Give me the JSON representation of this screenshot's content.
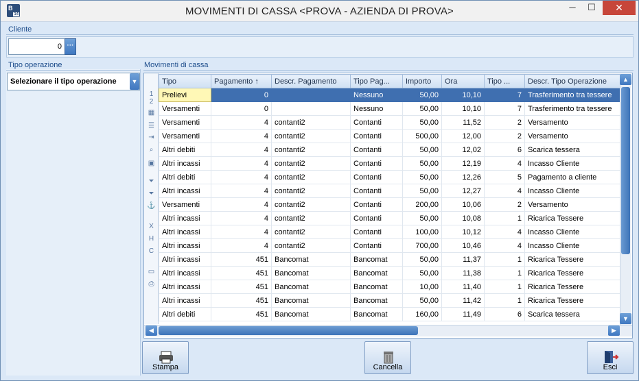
{
  "window": {
    "title": "MOVIMENTI DI CASSA <PROVA - AZIENDA DI PROVA>",
    "app_icon_letter": "B",
    "app_icon_badge": "14",
    "controls": {
      "minimize": "─",
      "maximize": "☐",
      "close": "✕"
    }
  },
  "cliente": {
    "label": "Cliente",
    "value": "0",
    "lookup_button": "···"
  },
  "tipo_operazione": {
    "label": "Tipo operazione",
    "selected": "Selezionare il tipo operazione"
  },
  "grid": {
    "label": "Movimenti di cassa",
    "row_numbers": [
      "1",
      "2"
    ],
    "columns": [
      "Tipo",
      "Pagamento ↑",
      "Descr. Pagamento",
      "Tipo Pag...",
      "Importo",
      "Ora",
      "Tipo ...",
      "Descr. Tipo Operazione"
    ],
    "rows": [
      [
        "Prelievi",
        "0",
        "",
        "Nessuno",
        "50,00",
        "10,10",
        "7",
        "Trasferimento tra tessere"
      ],
      [
        "Versamenti",
        "0",
        "",
        "Nessuno",
        "50,00",
        "10,10",
        "7",
        "Trasferimento tra tessere"
      ],
      [
        "Versamenti",
        "4",
        "contanti2",
        "Contanti",
        "50,00",
        "11,52",
        "2",
        "Versamento"
      ],
      [
        "Versamenti",
        "4",
        "contanti2",
        "Contanti",
        "500,00",
        "12,00",
        "2",
        "Versamento"
      ],
      [
        "Altri debiti",
        "4",
        "contanti2",
        "Contanti",
        "50,00",
        "12,02",
        "6",
        "Scarica tessera"
      ],
      [
        "Altri incassi",
        "4",
        "contanti2",
        "Contanti",
        "50,00",
        "12,19",
        "4",
        "Incasso Cliente"
      ],
      [
        "Altri debiti",
        "4",
        "contanti2",
        "Contanti",
        "50,00",
        "12,26",
        "5",
        "Pagamento a cliente"
      ],
      [
        "Altri incassi",
        "4",
        "contanti2",
        "Contanti",
        "50,00",
        "12,27",
        "4",
        "Incasso Cliente"
      ],
      [
        "Versamenti",
        "4",
        "contanti2",
        "Contanti",
        "200,00",
        "10,06",
        "2",
        "Versamento"
      ],
      [
        "Altri incassi",
        "4",
        "contanti2",
        "Contanti",
        "50,00",
        "10,08",
        "1",
        "Ricarica Tessere"
      ],
      [
        "Altri incassi",
        "4",
        "contanti2",
        "Contanti",
        "100,00",
        "10,12",
        "4",
        "Incasso Cliente"
      ],
      [
        "Altri incassi",
        "4",
        "contanti2",
        "Contanti",
        "700,00",
        "10,46",
        "4",
        "Incasso Cliente"
      ],
      [
        "Altri incassi",
        "451",
        "Bancomat",
        "Bancomat",
        "50,00",
        "11,37",
        "1",
        "Ricarica Tessere"
      ],
      [
        "Altri incassi",
        "451",
        "Bancomat",
        "Bancomat",
        "50,00",
        "11,38",
        "1",
        "Ricarica Tessere"
      ],
      [
        "Altri incassi",
        "451",
        "Bancomat",
        "Bancomat",
        "10,00",
        "11,40",
        "1",
        "Ricarica Tessere"
      ],
      [
        "Altri incassi",
        "451",
        "Bancomat",
        "Bancomat",
        "50,00",
        "11,42",
        "1",
        "Ricarica Tessere"
      ],
      [
        "Altri debiti",
        "451",
        "Bancomat",
        "Bancomat",
        "160,00",
        "11,49",
        "6",
        "Scarica tessera"
      ]
    ]
  },
  "buttons": {
    "stampa": "Stampa",
    "cancella": "Cancella",
    "esci": "Esci"
  },
  "colors": {
    "selection": "#3f6fb0",
    "current_cell": "#fff8b6",
    "accent": "#3f77c0",
    "close": "#c7463a"
  }
}
